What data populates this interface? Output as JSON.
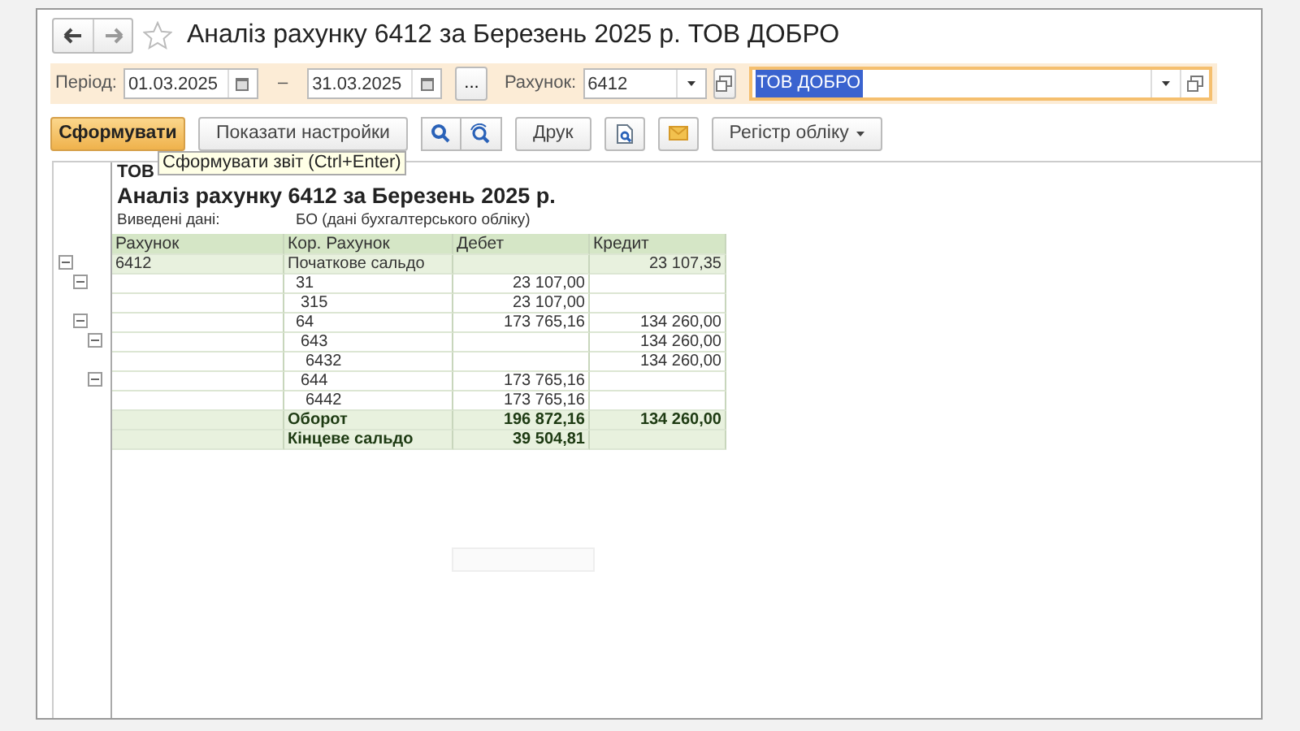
{
  "window": {
    "title": "Аналіз рахунку 6412 за Березень 2025 р. ТОВ ДОБРО",
    "favorite": false
  },
  "filters": {
    "period_label": "Період:",
    "date_from": "01.03.2025",
    "dash": "–",
    "date_to": "31.03.2025",
    "more_button": "...",
    "account_label": "Рахунок:",
    "account": "6412",
    "organization": "ТОВ ДОБРО",
    "organization_selected": true
  },
  "toolbar": [
    {
      "kind": "primary",
      "label": "Сформувати"
    },
    {
      "kind": "text",
      "label": "Показати настройки"
    },
    {
      "kind": "search"
    },
    {
      "kind": "search-next"
    },
    {
      "kind": "text",
      "label": "Друк"
    },
    {
      "kind": "preview"
    },
    {
      "kind": "mail"
    },
    {
      "kind": "dropdown",
      "label": "Регістр обліку"
    }
  ],
  "tooltip": "Сформувати звіт (Ctrl+Enter)",
  "report": {
    "company": "ТОВ",
    "title": "Аналіз рахунку 6412 за Березень 2025 р.",
    "data_label": "Виведені дані:",
    "data_value": "БО (дані бухгалтерського обліку)",
    "columns": [
      "Рахунок",
      "Кор. Рахунок",
      "Дебет",
      "Кредит"
    ],
    "rows": [
      {
        "account": "6412",
        "corr_account": "Початкове сальдо",
        "credit": "23 107,35",
        "expanded": true,
        "children": [
          {
            "corr_account": "31",
            "debit": "23 107,00",
            "expanded": true,
            "children": [
              {
                "corr_account": "315",
                "debit": "23 107,00"
              }
            ]
          },
          {
            "corr_account": "64",
            "debit": "173 765,16",
            "credit": "134 260,00",
            "expanded": true,
            "children": [
              {
                "corr_account": "643",
                "credit": "134 260,00",
                "expanded": true,
                "children": [
                  {
                    "corr_account": "6432",
                    "credit": "134 260,00"
                  }
                ]
              },
              {
                "corr_account": "644",
                "debit": "173 765,16",
                "expanded": true,
                "children": [
                  {
                    "corr_account": "6442",
                    "debit": "173 765,16"
                  }
                ]
              }
            ]
          }
        ]
      }
    ],
    "totals": [
      {
        "corr_account": "Оборот",
        "debit": "196 872,16",
        "credit": "134 260,00"
      },
      {
        "corr_account": "Кінцеве сальдо",
        "debit": "39 504,81"
      }
    ]
  }
}
